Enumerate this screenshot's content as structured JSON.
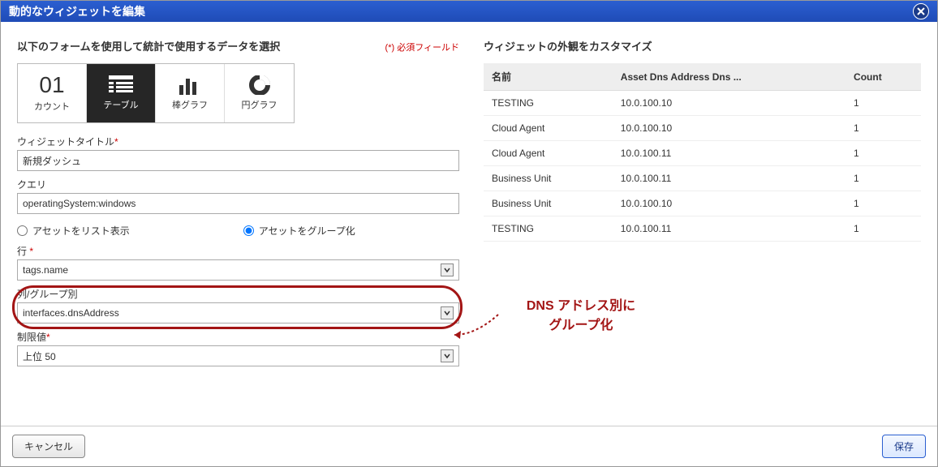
{
  "titlebar": {
    "title": "動的なウィジェットを編集"
  },
  "left": {
    "heading": "以下のフォームを使用して統計で使用するデータを選択",
    "required_note": "(*) 必須フィールド",
    "types": {
      "count": {
        "big": "01",
        "label": "カウント"
      },
      "table": {
        "label": "テーブル"
      },
      "bar": {
        "label": "棒グラフ"
      },
      "pie": {
        "label": "円グラフ"
      }
    },
    "fields": {
      "title_label": "ウィジェットタイトル",
      "title_value": "新規ダッシュ",
      "query_label": "クエリ",
      "query_value": "operatingSystem:windows",
      "radio_list": "アセットをリスト表示",
      "radio_group": "アセットをグループ化",
      "row_label": "行",
      "row_value": "tags.name",
      "col_label": "列/グループ別",
      "col_value": "interfaces.dnsAddress",
      "limit_label": "制限値",
      "limit_value": "上位 50"
    }
  },
  "right": {
    "heading": "ウィジェットの外観をカスタマイズ",
    "columns": {
      "name": "名前",
      "addr": "Asset Dns Address Dns ...",
      "count": "Count"
    },
    "rows": [
      {
        "name": "TESTING",
        "addr": "10.0.100.10",
        "count": "1"
      },
      {
        "name": "Cloud Agent",
        "addr": "10.0.100.10",
        "count": "1"
      },
      {
        "name": "Cloud Agent",
        "addr": "10.0.100.11",
        "count": "1"
      },
      {
        "name": "Business Unit",
        "addr": "10.0.100.11",
        "count": "1"
      },
      {
        "name": "Business Unit",
        "addr": "10.0.100.10",
        "count": "1"
      },
      {
        "name": "TESTING",
        "addr": "10.0.100.11",
        "count": "1"
      }
    ]
  },
  "annotation": {
    "line1": "DNS アドレス別に",
    "line2": "グループ化"
  },
  "footer": {
    "cancel": "キャンセル",
    "save": "保存"
  }
}
